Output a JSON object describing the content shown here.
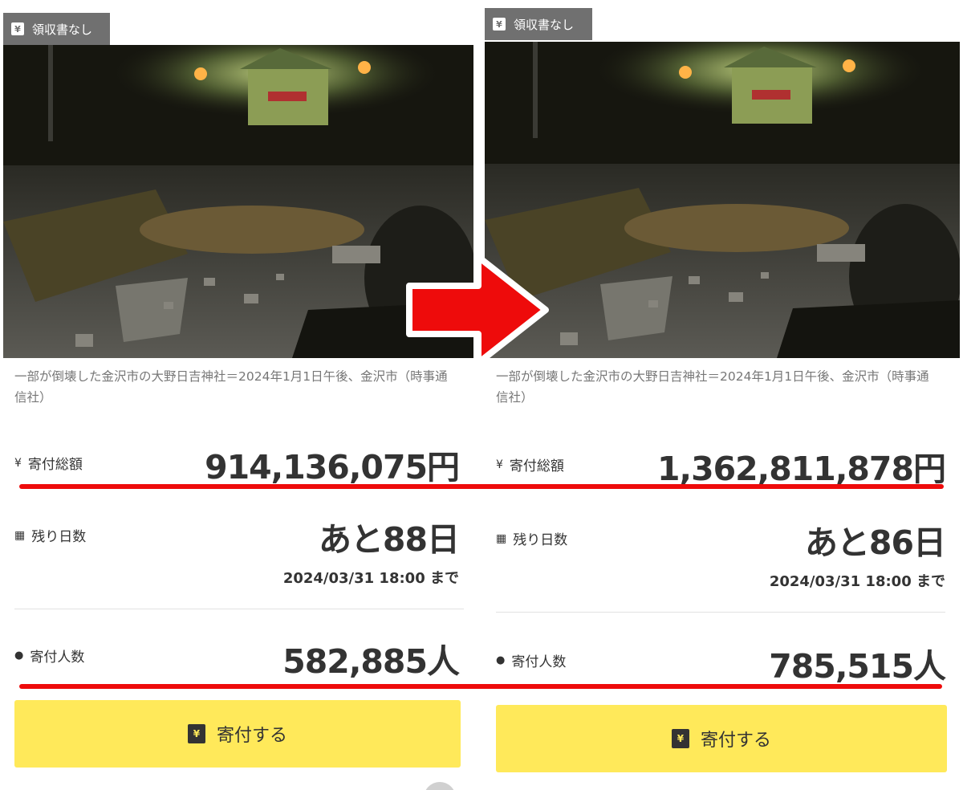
{
  "left": {
    "badge": "領収書なし",
    "caption": "一部が倒壊した金沢市の大野日吉神社＝2024年1月1日午後、金沢市（時事通信社）",
    "total": {
      "label": "寄付総額",
      "value": "914,136,075円"
    },
    "remaining": {
      "label": "残り日数",
      "value": "あと88日",
      "deadline": "2024/03/31 18:00 まで"
    },
    "donors": {
      "label": "寄付人数",
      "value": "582,885人"
    },
    "button_label": "寄付する"
  },
  "right": {
    "badge": "領収書なし",
    "caption": "一部が倒壊した金沢市の大野日吉神社＝2024年1月1日午後、金沢市（時事通信社）",
    "total": {
      "label": "寄付総額",
      "value": "1,362,811,878円"
    },
    "remaining": {
      "label": "残り日数",
      "value": "あと86日",
      "deadline": "2024/03/31 18:00 まで"
    },
    "donors": {
      "label": "寄付人数",
      "value": "785,515人"
    },
    "button_label": "寄付する"
  },
  "icons": {
    "receipt": "yen-receipt-icon",
    "total": "yen-icon",
    "remaining": "calendar-icon",
    "donors": "person-icon",
    "donate": "donation-box-icon",
    "transition": "red-arrow-icon"
  },
  "colors": {
    "accent_red": "#ee0b0b",
    "button_yellow": "#ffe95a",
    "badge_gray": "#707070",
    "text_dark": "#333333"
  }
}
